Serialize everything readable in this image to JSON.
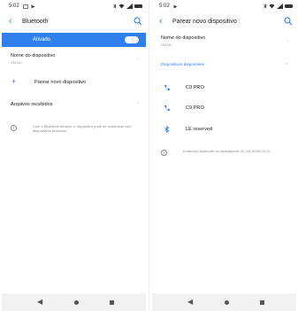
{
  "left": {
    "status": {
      "time": "5:02"
    },
    "header": {
      "title": "Bluetooth"
    },
    "toggle": {
      "label": "Ativado"
    },
    "device_name": {
      "title": "Nome do dispositivo",
      "value": "SM-NC"
    },
    "pair_new": {
      "label": "Parear novo dispositivo"
    },
    "received_files": {
      "label": "Arquivos recebidos"
    },
    "info": {
      "text": "Com o Bluetooth ativado, o dispositivo pode se comunicar com dispositivos próximos."
    }
  },
  "right": {
    "status": {
      "time": "5:02"
    },
    "header": {
      "title": "Parear novo dispositivo"
    },
    "device_name": {
      "title": "Nome do dispositivo",
      "value": "SM-NC"
    },
    "section_title": "Dispositivos disponíveis",
    "devices": [
      {
        "name": "C9 PRO",
        "icon": "phone-icon"
      },
      {
        "name": "C9 PRO",
        "icon": "phone-icon"
      },
      {
        "name": "LE reserved",
        "icon": "bluetooth-icon"
      }
    ],
    "info": {
      "text": "Endereço Bluetooth do smartphone: 4C:4E:35:00:00:7C"
    }
  },
  "colors": {
    "accent": "#2f80ed",
    "navbar": "#f2f2f2"
  },
  "icons": {
    "back": "‹",
    "chevron": "›",
    "plus": "+",
    "info": "i",
    "nav_back": "◀"
  }
}
